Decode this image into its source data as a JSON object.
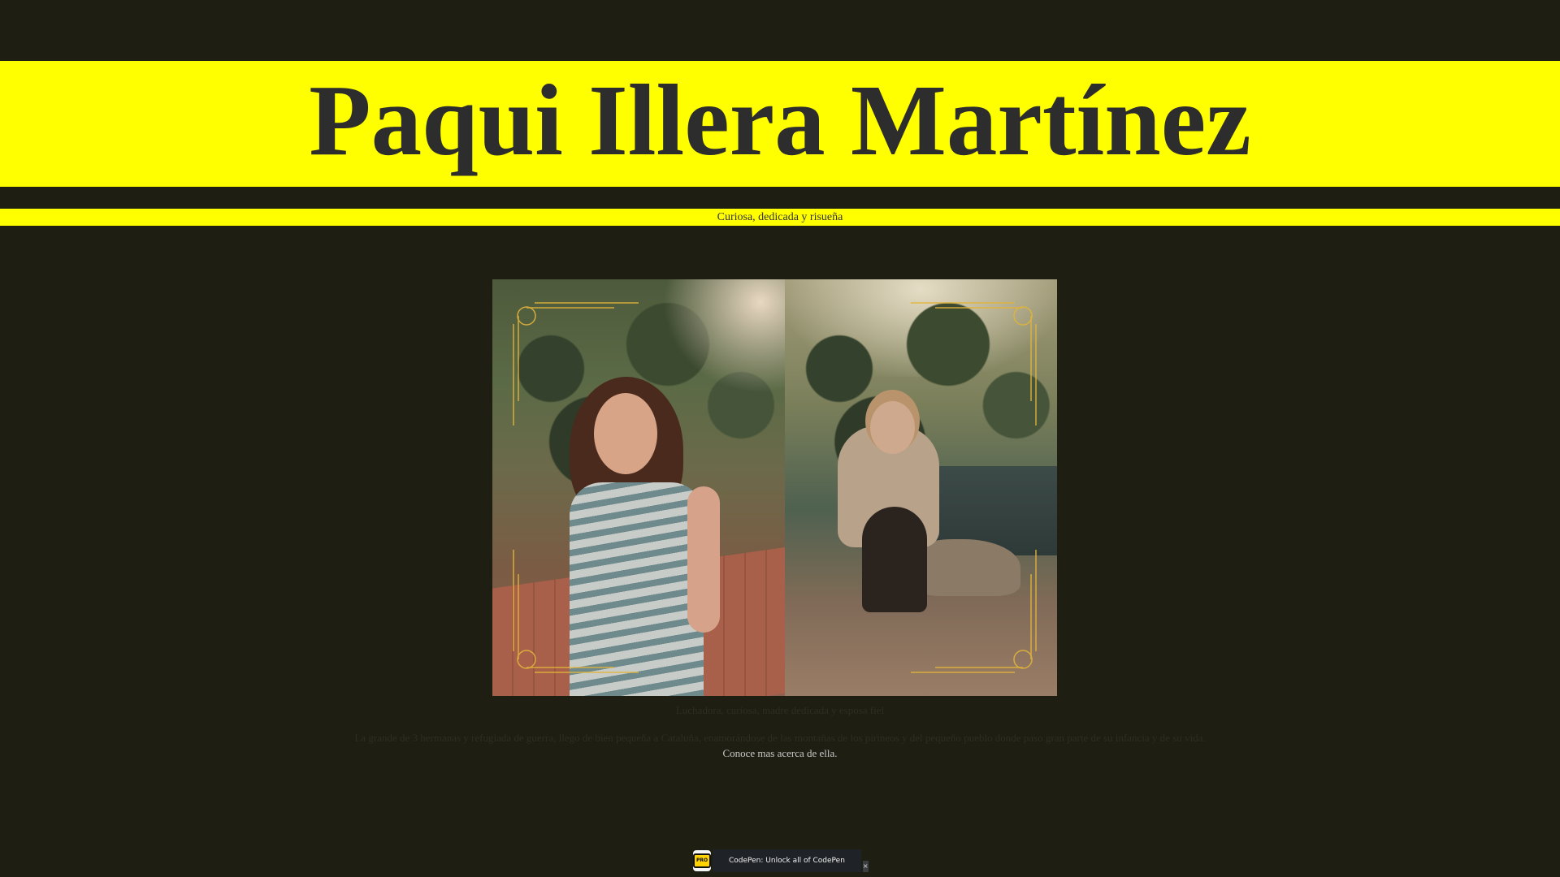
{
  "header": {
    "title": "Paqui Illera Martínez",
    "subtitle": "Curiosa, dedicada y risueña"
  },
  "image": {
    "alt": "Paqui Illera Martínez"
  },
  "content": {
    "caption": "Luchadora, curiosa, madre dedicada y esposa fiel",
    "bio": "La grande de 3 hermanas y refugiada de guerra, llego de bien pequeña a Cataluña, enamorándose de las montañas de los pirineos y del pequeño pueblo donde paso gran parte de su infancia y de su vida.",
    "more_link": "Conoce mas acerca de ella."
  },
  "codepen_bar": {
    "logo": "PRO",
    "text": "CodePen: Unlock all of CodePen",
    "close": "×"
  },
  "colors": {
    "background": "#1e1e13",
    "accent": "#ffff00",
    "title": "#2d2d2d"
  }
}
